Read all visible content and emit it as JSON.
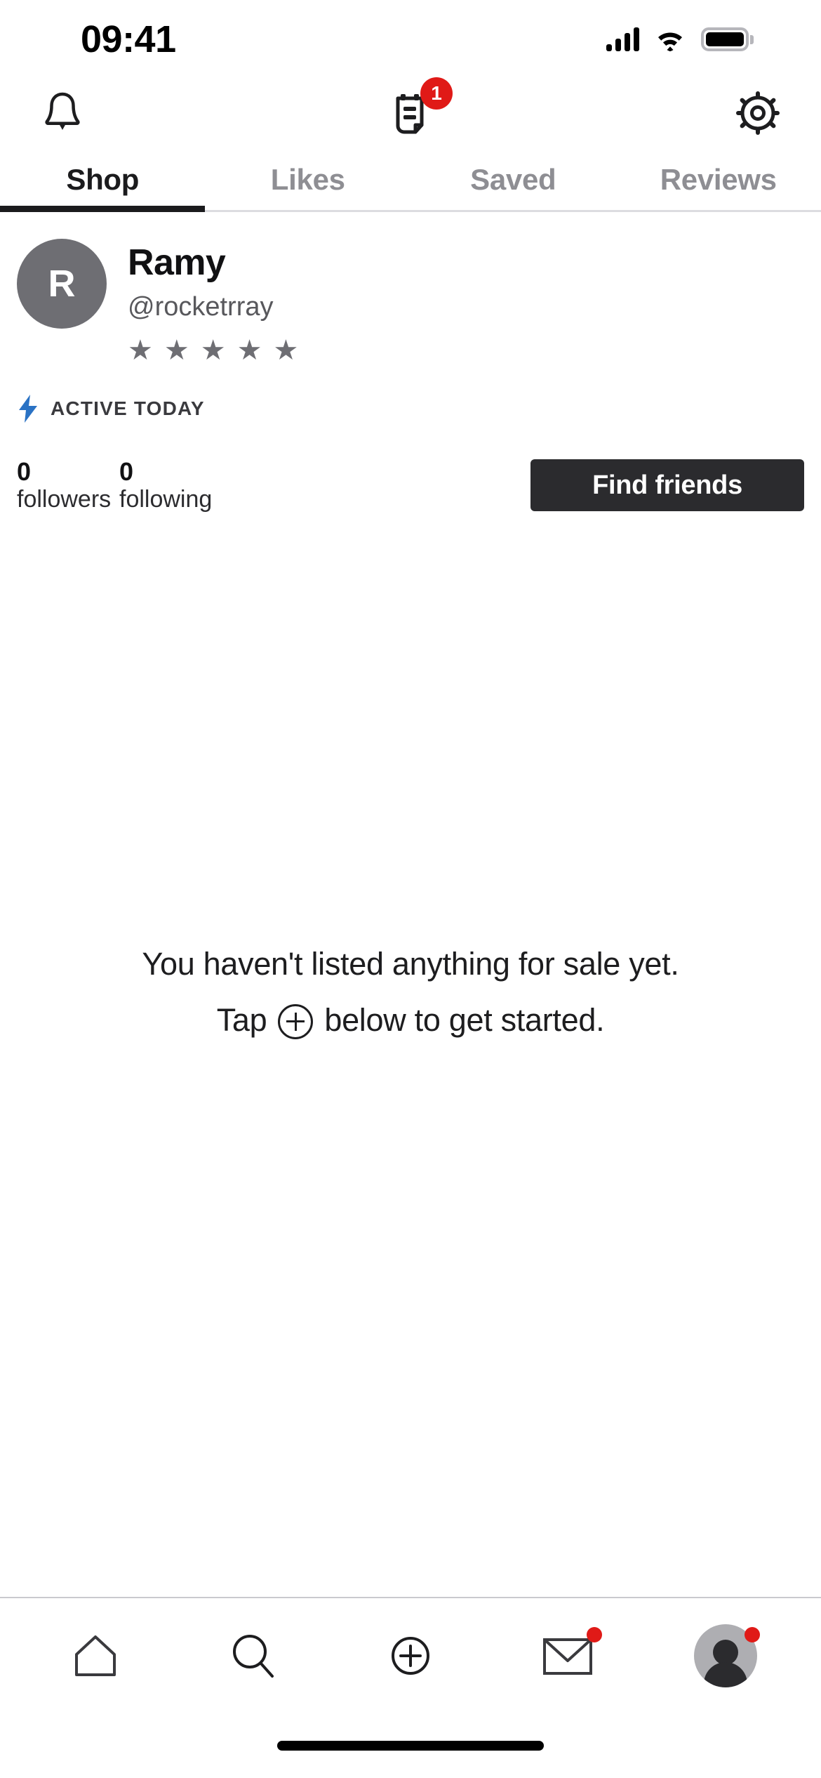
{
  "status_bar": {
    "time": "09:41",
    "cellular_icon": "signal-bars-icon",
    "wifi_icon": "wifi-icon",
    "battery_icon": "battery-full-icon"
  },
  "top_bar": {
    "notifications_icon": "bell-icon",
    "orders_icon": "receipt-icon",
    "orders_badge": "1",
    "settings_icon": "gear-icon",
    "badge_color": "#e01a17"
  },
  "tabs": {
    "items": [
      {
        "label": "Shop",
        "active": true
      },
      {
        "label": "Likes",
        "active": false
      },
      {
        "label": "Saved",
        "active": false
      },
      {
        "label": "Reviews",
        "active": false
      }
    ],
    "active_color": "#1b1b1d",
    "inactive_color": "#8e8e93"
  },
  "profile": {
    "avatar_initial": "R",
    "avatar_color": "#6e6e73",
    "display_name": "Ramy",
    "handle": "@rocketrray",
    "rating_stars": 5,
    "star_glyph": "★",
    "star_color": "#6e6e73",
    "activity_icon": "lightning-bolt-icon",
    "activity_icon_color": "#2a72c4",
    "activity_label": "ACTIVE TODAY"
  },
  "stats": {
    "followers_count": "0",
    "followers_label": "followers",
    "following_count": "0",
    "following_label": "following",
    "find_friends_label": "Find friends",
    "find_friends_color": "#2b2b2e"
  },
  "empty_state": {
    "line1": "You haven't listed anything for sale yet.",
    "tap_prefix": "Tap",
    "plus_icon": "plus-circle-icon",
    "tap_suffix": "below to get started."
  },
  "bottom_nav": {
    "items": [
      {
        "name": "home",
        "icon": "home-icon",
        "badge": false
      },
      {
        "name": "search",
        "icon": "search-icon",
        "badge": false
      },
      {
        "name": "sell",
        "icon": "plus-circle-icon",
        "badge": false
      },
      {
        "name": "inbox",
        "icon": "envelope-icon",
        "badge": true
      },
      {
        "name": "profile",
        "icon": "profile-avatar-icon",
        "badge": true
      }
    ],
    "badge_color": "#e01a17"
  },
  "home_indicator": {
    "icon": "home-indicator-bar"
  }
}
